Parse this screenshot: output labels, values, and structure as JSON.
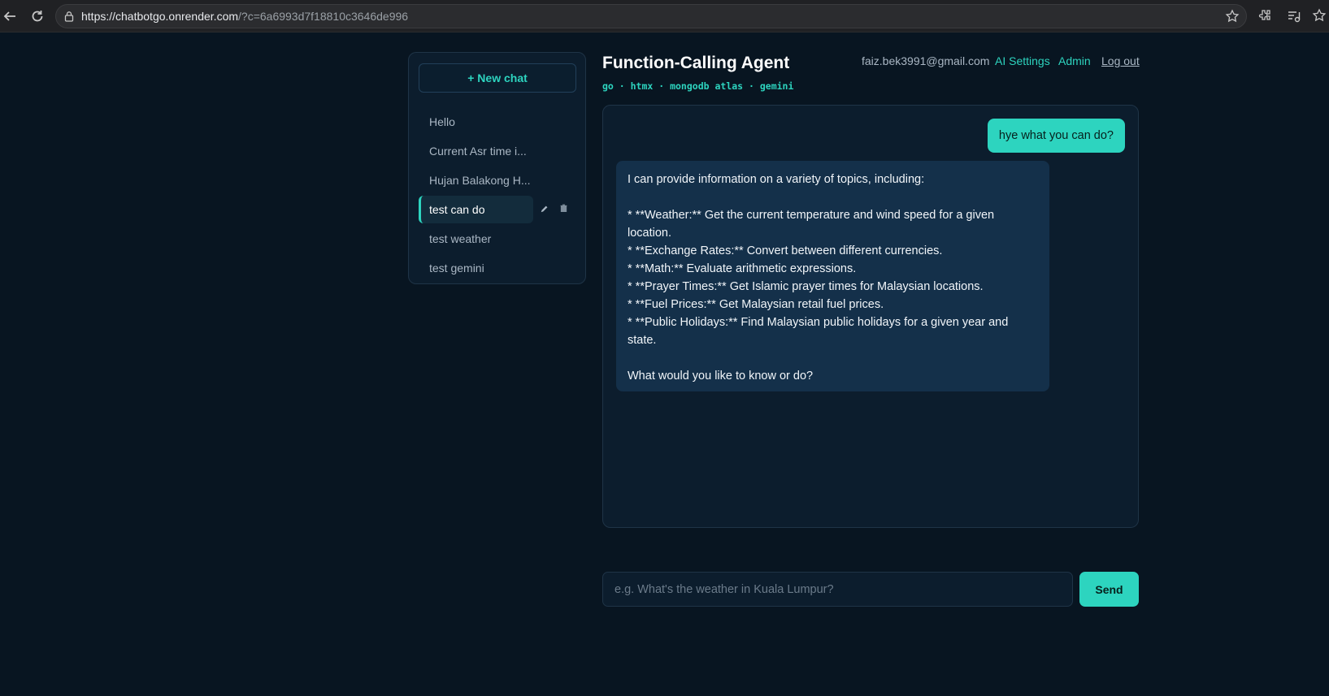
{
  "browser": {
    "url_domain": "https://chatbotgo.onrender.com",
    "url_query": "/?c=6a6993d7f18810c3646de996"
  },
  "sidebar": {
    "new_chat_label": "+ New chat",
    "items": [
      {
        "label": "Hello"
      },
      {
        "label": "Current Asr time i..."
      },
      {
        "label": "Hujan Balakong H..."
      },
      {
        "label": "test can do",
        "active": true
      },
      {
        "label": "test weather"
      },
      {
        "label": "test gemini"
      }
    ],
    "edit_icon": "pencil-icon",
    "delete_icon": "trash-icon"
  },
  "header": {
    "title": "Function-Calling Agent",
    "subtitle": "go · htmx · mongodb atlas · gemini",
    "user_email": "faiz.bek3991@gmail.com",
    "ai_settings_label": "AI Settings",
    "admin_label": "Admin",
    "logout_label": "Log out"
  },
  "chat": {
    "messages": [
      {
        "role": "user",
        "text": "hye what you can do?"
      },
      {
        "role": "assistant",
        "text": "I can provide information on a variety of topics, including:\n\n* **Weather:** Get the current temperature and wind speed for a given location.\n* **Exchange Rates:** Convert between different currencies.\n* **Math:** Evaluate arithmetic expressions.\n* **Prayer Times:** Get Islamic prayer times for Malaysian locations.\n* **Fuel Prices:** Get Malaysian retail fuel prices.\n* **Public Holidays:** Find Malaysian public holidays for a given year and state.\n\nWhat would you like to know or do?"
      }
    ]
  },
  "composer": {
    "placeholder": "e.g. What's the weather in Kuala Lumpur?",
    "value": "",
    "send_label": "Send"
  },
  "colors": {
    "accent": "#2dd4bf",
    "background": "#081521",
    "panel": "#0c1d2d",
    "assistant_bubble": "#14304a"
  }
}
